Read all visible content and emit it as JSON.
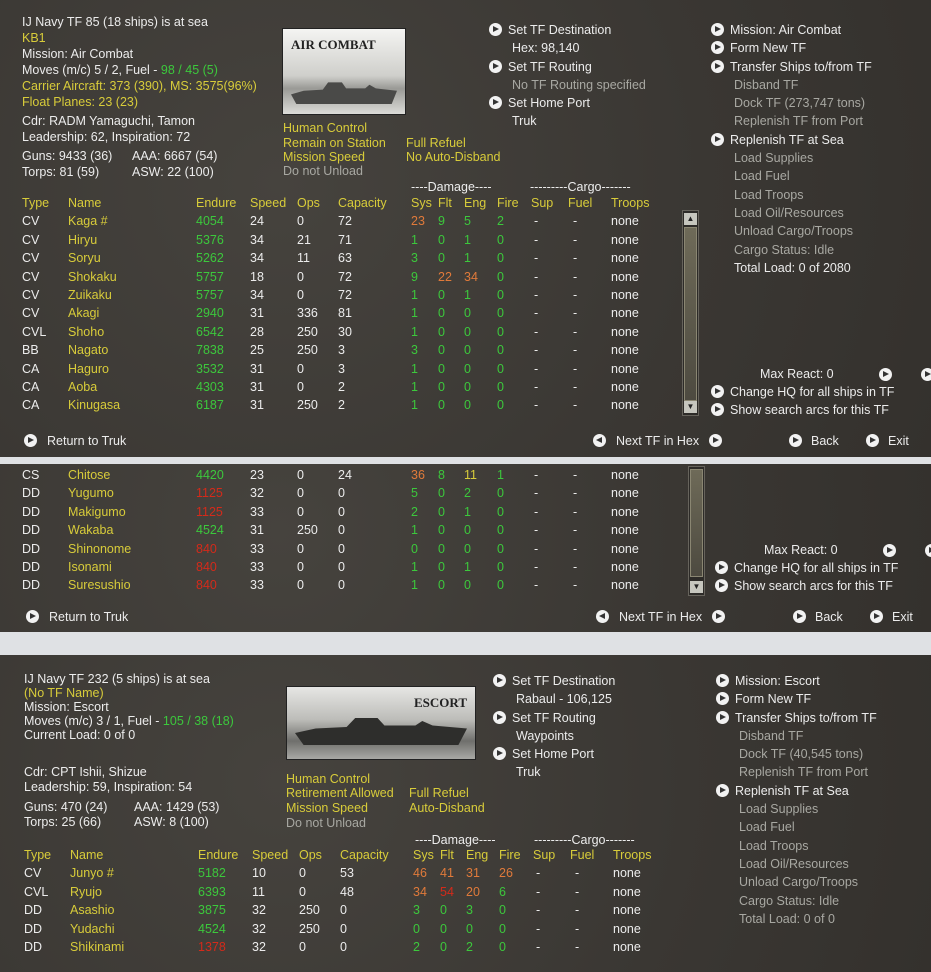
{
  "tf1": {
    "title": "IJ Navy TF 85 (18 ships) is at sea",
    "name": "KB1",
    "mission": "Mission: Air Combat",
    "moves_pre": "Moves (m/c) 5 / 2, Fuel - ",
    "moves_fuel": "98 / 45 (5)",
    "carrier_aircraft": "Carrier Aircraft: 373 (390), MS: 3575(96%)",
    "float_planes": "Float Planes: 23 (23)",
    "cdr": "Cdr: RADM Yamaguchi, Tamon",
    "leadership": "Leadership: 62, Inspiration: 72",
    "guns": "Guns: 9433 (36)",
    "aaa": "AAA: 6667 (54)",
    "torps": "Torps: 81 (59)",
    "asw": "ASW: 22 (100)",
    "image_label": "AIR COMBAT",
    "control": "Human Control",
    "station": "Remain on Station",
    "refuel": "Full Refuel",
    "speed": "Mission Speed",
    "disband": "No Auto-Disband",
    "unload": "Do not Unload",
    "mid_menu": {
      "set_dest": "Set TF Destination",
      "hex": "Hex: 98,140",
      "set_routing": "Set TF Routing",
      "routing_status": "No TF Routing specified",
      "set_home": "Set Home Port",
      "home": "Truk"
    },
    "right_menu": {
      "mission": "Mission: Air Combat",
      "form": "Form New TF",
      "transfer": "Transfer Ships to/from TF",
      "disband": "Disband TF",
      "dock": "Dock TF (273,747 tons)",
      "replenish_port": "Replenish TF from Port",
      "replenish_sea": "Replenish TF at Sea",
      "load_supplies": "Load Supplies",
      "load_fuel": "Load Fuel",
      "load_troops": "Load Troops",
      "load_oil": "Load Oil/Resources",
      "unload_cargo": "Unload Cargo/Troops",
      "cargo_status": "Cargo Status: Idle",
      "total_load": "Total Load: 0 of 2080"
    },
    "max_react": "Max React: 0",
    "change_hq": "Change HQ for all ships in TF",
    "search_arcs": "Show search arcs for this TF",
    "return": "Return to Truk",
    "next_tf": "Next TF in Hex",
    "back": "Back",
    "exit": "Exit"
  },
  "headers": {
    "group_damage": "----Damage----",
    "group_cargo": "---------Cargo-------",
    "type": "Type",
    "name": "Name",
    "endure": "Endure",
    "speed": "Speed",
    "ops": "Ops",
    "capacity": "Capacity",
    "sys": "Sys",
    "flt": "Flt",
    "eng": "Eng",
    "fire": "Fire",
    "sup": "Sup",
    "fuel": "Fuel",
    "troops": "Troops"
  },
  "ships1": [
    {
      "type": "CV",
      "name": "Kaga #",
      "endure": "4054",
      "ec": "g",
      "speed": "24",
      "ops": "0",
      "cap": "72",
      "sys": "23",
      "flt": "9",
      "eng": "5",
      "fire": "2",
      "sc": "o",
      "fc": "g",
      "ec2": "g",
      "frc": "g",
      "sup": "-",
      "fuel": "-",
      "troops": "none"
    },
    {
      "type": "CV",
      "name": "Hiryu",
      "endure": "5376",
      "ec": "g",
      "speed": "34",
      "ops": "21",
      "cap": "71",
      "sys": "1",
      "flt": "0",
      "eng": "1",
      "fire": "0",
      "sc": "g",
      "fc": "g",
      "ec2": "g",
      "frc": "g",
      "sup": "-",
      "fuel": "-",
      "troops": "none"
    },
    {
      "type": "CV",
      "name": "Soryu",
      "endure": "5262",
      "ec": "g",
      "speed": "34",
      "ops": "11",
      "cap": "63",
      "sys": "3",
      "flt": "0",
      "eng": "1",
      "fire": "0",
      "sc": "g",
      "fc": "g",
      "ec2": "g",
      "frc": "g",
      "sup": "-",
      "fuel": "-",
      "troops": "none"
    },
    {
      "type": "CV",
      "name": "Shokaku",
      "endure": "5757",
      "ec": "g",
      "speed": "18",
      "ops": "0",
      "cap": "72",
      "sys": "9",
      "flt": "22",
      "eng": "34",
      "fire": "0",
      "sc": "g",
      "fc": "o",
      "ec2": "o",
      "frc": "g",
      "sup": "-",
      "fuel": "-",
      "troops": "none"
    },
    {
      "type": "CV",
      "name": "Zuikaku",
      "endure": "5757",
      "ec": "g",
      "speed": "34",
      "ops": "0",
      "cap": "72",
      "sys": "1",
      "flt": "0",
      "eng": "1",
      "fire": "0",
      "sc": "g",
      "fc": "g",
      "ec2": "g",
      "frc": "g",
      "sup": "-",
      "fuel": "-",
      "troops": "none"
    },
    {
      "type": "CV",
      "name": "Akagi",
      "endure": "2940",
      "ec": "g",
      "speed": "31",
      "ops": "336",
      "cap": "81",
      "sys": "1",
      "flt": "0",
      "eng": "0",
      "fire": "0",
      "sc": "g",
      "fc": "g",
      "ec2": "g",
      "frc": "g",
      "sup": "-",
      "fuel": "-",
      "troops": "none"
    },
    {
      "type": "CVL",
      "name": "Shoho",
      "endure": "6542",
      "ec": "g",
      "speed": "28",
      "ops": "250",
      "cap": "30",
      "sys": "1",
      "flt": "0",
      "eng": "0",
      "fire": "0",
      "sc": "g",
      "fc": "g",
      "ec2": "g",
      "frc": "g",
      "sup": "-",
      "fuel": "-",
      "troops": "none"
    },
    {
      "type": "BB",
      "name": "Nagato",
      "endure": "7838",
      "ec": "g",
      "speed": "25",
      "ops": "250",
      "cap": "3",
      "sys": "3",
      "flt": "0",
      "eng": "0",
      "fire": "0",
      "sc": "g",
      "fc": "g",
      "ec2": "g",
      "frc": "g",
      "sup": "-",
      "fuel": "-",
      "troops": "none"
    },
    {
      "type": "CA",
      "name": "Haguro",
      "endure": "3532",
      "ec": "g",
      "speed": "31",
      "ops": "0",
      "cap": "3",
      "sys": "1",
      "flt": "0",
      "eng": "0",
      "fire": "0",
      "sc": "g",
      "fc": "g",
      "ec2": "g",
      "frc": "g",
      "sup": "-",
      "fuel": "-",
      "troops": "none"
    },
    {
      "type": "CA",
      "name": "Aoba",
      "endure": "4303",
      "ec": "g",
      "speed": "31",
      "ops": "0",
      "cap": "2",
      "sys": "1",
      "flt": "0",
      "eng": "0",
      "fire": "0",
      "sc": "g",
      "fc": "g",
      "ec2": "g",
      "frc": "g",
      "sup": "-",
      "fuel": "-",
      "troops": "none"
    },
    {
      "type": "CA",
      "name": "Kinugasa",
      "endure": "6187",
      "ec": "g",
      "speed": "31",
      "ops": "250",
      "cap": "2",
      "sys": "1",
      "flt": "0",
      "eng": "0",
      "fire": "0",
      "sc": "g",
      "fc": "g",
      "ec2": "g",
      "frc": "g",
      "sup": "-",
      "fuel": "-",
      "troops": "none"
    }
  ],
  "ships2": [
    {
      "type": "CS",
      "name": "Chitose",
      "endure": "4420",
      "ec": "g",
      "speed": "23",
      "ops": "0",
      "cap": "24",
      "sys": "36",
      "flt": "8",
      "eng": "11",
      "fire": "1",
      "sc": "o",
      "fc": "g",
      "ec2": "y",
      "frc": "g",
      "sup": "-",
      "fuel": "-",
      "troops": "none"
    },
    {
      "type": "DD",
      "name": "Yugumo",
      "endure": "1125",
      "ec": "r",
      "speed": "32",
      "ops": "0",
      "cap": "0",
      "sys": "5",
      "flt": "0",
      "eng": "2",
      "fire": "0",
      "sc": "g",
      "fc": "g",
      "ec2": "g",
      "frc": "g",
      "sup": "-",
      "fuel": "-",
      "troops": "none"
    },
    {
      "type": "DD",
      "name": "Makigumo",
      "endure": "1125",
      "ec": "r",
      "speed": "33",
      "ops": "0",
      "cap": "0",
      "sys": "2",
      "flt": "0",
      "eng": "1",
      "fire": "0",
      "sc": "g",
      "fc": "g",
      "ec2": "g",
      "frc": "g",
      "sup": "-",
      "fuel": "-",
      "troops": "none"
    },
    {
      "type": "DD",
      "name": "Wakaba",
      "endure": "4524",
      "ec": "g",
      "speed": "31",
      "ops": "250",
      "cap": "0",
      "sys": "1",
      "flt": "0",
      "eng": "0",
      "fire": "0",
      "sc": "g",
      "fc": "g",
      "ec2": "g",
      "frc": "g",
      "sup": "-",
      "fuel": "-",
      "troops": "none"
    },
    {
      "type": "DD",
      "name": "Shinonome",
      "endure": "840",
      "ec": "r",
      "speed": "33",
      "ops": "0",
      "cap": "0",
      "sys": "0",
      "flt": "0",
      "eng": "0",
      "fire": "0",
      "sc": "g",
      "fc": "g",
      "ec2": "g",
      "frc": "g",
      "sup": "-",
      "fuel": "-",
      "troops": "none"
    },
    {
      "type": "DD",
      "name": "Isonami",
      "endure": "840",
      "ec": "r",
      "speed": "33",
      "ops": "0",
      "cap": "0",
      "sys": "1",
      "flt": "0",
      "eng": "1",
      "fire": "0",
      "sc": "g",
      "fc": "g",
      "ec2": "g",
      "frc": "g",
      "sup": "-",
      "fuel": "-",
      "troops": "none"
    },
    {
      "type": "DD",
      "name": "Suresushio",
      "endure": "840",
      "ec": "r",
      "speed": "33",
      "ops": "0",
      "cap": "0",
      "sys": "1",
      "flt": "0",
      "eng": "0",
      "fire": "0",
      "sc": "g",
      "fc": "g",
      "ec2": "g",
      "frc": "g",
      "sup": "-",
      "fuel": "-",
      "troops": "none"
    }
  ],
  "p2": {
    "max_react": "Max React: 0",
    "change_hq": "Change HQ for all ships in TF",
    "search_arcs": "Show search arcs for this TF",
    "return": "Return to Truk",
    "next_tf": "Next TF in Hex",
    "back": "Back",
    "exit": "Exit"
  },
  "tf2": {
    "title": "IJ Navy TF 232 (5 ships) is at sea",
    "name": "(No TF Name)",
    "mission": "Mission: Escort",
    "moves_pre": "Moves (m/c) 3 / 1, Fuel - ",
    "moves_fuel": "105 / 38 (18)",
    "current_load": "Current Load: 0 of 0",
    "cdr": "Cdr: CPT Ishii, Shizue",
    "leadership": "Leadership: 59, Inspiration: 54",
    "guns": "Guns: 470 (24)",
    "aaa": "AAA: 1429 (53)",
    "torps": "Torps: 25 (66)",
    "asw": "ASW: 8 (100)",
    "image_label": "ESCORT",
    "control": "Human Control",
    "station": "Retirement Allowed",
    "refuel": "Full Refuel",
    "speed": "Mission Speed",
    "disband": "Auto-Disband",
    "unload": "Do not Unload",
    "mid_menu": {
      "set_dest": "Set TF Destination",
      "hex": "Rabaul - 106,125",
      "set_routing": "Set TF Routing",
      "routing_status": "Waypoints",
      "set_home": "Set Home Port",
      "home": "Truk"
    },
    "right_menu": {
      "mission": "Mission: Escort",
      "form": "Form New TF",
      "transfer": "Transfer Ships to/from TF",
      "disband": "Disband TF",
      "dock": "Dock TF (40,545 tons)",
      "replenish_port": "Replenish TF from Port",
      "replenish_sea": "Replenish TF at Sea",
      "load_supplies": "Load Supplies",
      "load_fuel": "Load Fuel",
      "load_troops": "Load Troops",
      "load_oil": "Load Oil/Resources",
      "unload_cargo": "Unload Cargo/Troops",
      "cargo_status": "Cargo Status: Idle",
      "total_load": "Total Load: 0 of 0"
    }
  },
  "ships3": [
    {
      "type": "CV",
      "name": "Junyo #",
      "endure": "5182",
      "ec": "g",
      "speed": "10",
      "ops": "0",
      "cap": "53",
      "sys": "46",
      "flt": "41",
      "eng": "31",
      "fire": "26",
      "sc": "o",
      "fc": "o",
      "ec2": "o",
      "frc": "o",
      "sup": "-",
      "fuel": "-",
      "troops": "none"
    },
    {
      "type": "CVL",
      "name": "Ryujo",
      "endure": "6393",
      "ec": "g",
      "speed": "11",
      "ops": "0",
      "cap": "48",
      "sys": "34",
      "flt": "54",
      "eng": "20",
      "fire": "6",
      "sc": "o",
      "fc": "r",
      "ec2": "o",
      "frc": "g",
      "sup": "-",
      "fuel": "-",
      "troops": "none"
    },
    {
      "type": "DD",
      "name": "Asashio",
      "endure": "3875",
      "ec": "g",
      "speed": "32",
      "ops": "250",
      "cap": "0",
      "sys": "3",
      "flt": "0",
      "eng": "3",
      "fire": "0",
      "sc": "g",
      "fc": "g",
      "ec2": "g",
      "frc": "g",
      "sup": "-",
      "fuel": "-",
      "troops": "none"
    },
    {
      "type": "DD",
      "name": "Yudachi",
      "endure": "4524",
      "ec": "g",
      "speed": "32",
      "ops": "250",
      "cap": "0",
      "sys": "0",
      "flt": "0",
      "eng": "0",
      "fire": "0",
      "sc": "g",
      "fc": "g",
      "ec2": "g",
      "frc": "g",
      "sup": "-",
      "fuel": "-",
      "troops": "none"
    },
    {
      "type": "DD",
      "name": "Shikinami",
      "endure": "1378",
      "ec": "r",
      "speed": "32",
      "ops": "0",
      "cap": "0",
      "sys": "2",
      "flt": "0",
      "eng": "2",
      "fire": "0",
      "sc": "g",
      "fc": "g",
      "ec2": "g",
      "frc": "g",
      "sup": "-",
      "fuel": "-",
      "troops": "none"
    }
  ]
}
